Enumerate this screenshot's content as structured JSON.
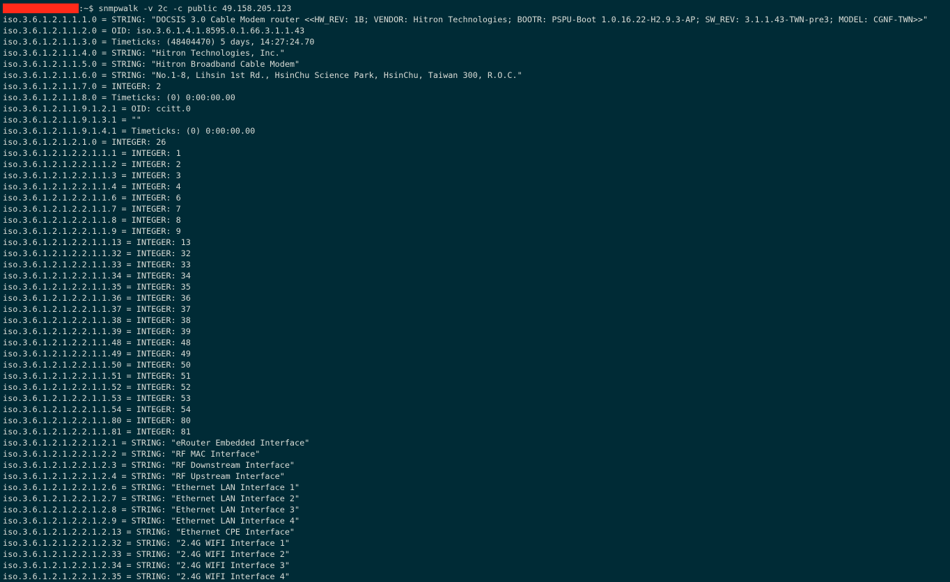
{
  "prompt": {
    "redaction_color": "#ff2a1a",
    "suffix": ":~$ ",
    "command": "snmpwalk -v 2c -c public 49.158.205.123"
  },
  "output_lines": [
    "iso.3.6.1.2.1.1.1.0 = STRING: \"DOCSIS 3.0 Cable Modem router <<HW_REV: 1B; VENDOR: Hitron Technologies; BOOTR: PSPU-Boot 1.0.16.22-H2.9.3-AP; SW_REV: 3.1.1.43-TWN-pre3; MODEL: CGNF-TWN>>\"",
    "iso.3.6.1.2.1.1.2.0 = OID: iso.3.6.1.4.1.8595.0.1.66.3.1.1.43",
    "iso.3.6.1.2.1.1.3.0 = Timeticks: (48404470) 5 days, 14:27:24.70",
    "iso.3.6.1.2.1.1.4.0 = STRING: \"Hitron Technologies, Inc.\"",
    "iso.3.6.1.2.1.1.5.0 = STRING: \"Hitron Broadband Cable Modem\"",
    "iso.3.6.1.2.1.1.6.0 = STRING: \"No.1-8, Lihsin 1st Rd., HsinChu Science Park, HsinChu, Taiwan 300, R.O.C.\"",
    "iso.3.6.1.2.1.1.7.0 = INTEGER: 2",
    "iso.3.6.1.2.1.1.8.0 = Timeticks: (0) 0:00:00.00",
    "iso.3.6.1.2.1.1.9.1.2.1 = OID: ccitt.0",
    "iso.3.6.1.2.1.1.9.1.3.1 = \"\"",
    "iso.3.6.1.2.1.1.9.1.4.1 = Timeticks: (0) 0:00:00.00",
    "iso.3.6.1.2.1.2.1.0 = INTEGER: 26",
    "iso.3.6.1.2.1.2.2.1.1.1 = INTEGER: 1",
    "iso.3.6.1.2.1.2.2.1.1.2 = INTEGER: 2",
    "iso.3.6.1.2.1.2.2.1.1.3 = INTEGER: 3",
    "iso.3.6.1.2.1.2.2.1.1.4 = INTEGER: 4",
    "iso.3.6.1.2.1.2.2.1.1.6 = INTEGER: 6",
    "iso.3.6.1.2.1.2.2.1.1.7 = INTEGER: 7",
    "iso.3.6.1.2.1.2.2.1.1.8 = INTEGER: 8",
    "iso.3.6.1.2.1.2.2.1.1.9 = INTEGER: 9",
    "iso.3.6.1.2.1.2.2.1.1.13 = INTEGER: 13",
    "iso.3.6.1.2.1.2.2.1.1.32 = INTEGER: 32",
    "iso.3.6.1.2.1.2.2.1.1.33 = INTEGER: 33",
    "iso.3.6.1.2.1.2.2.1.1.34 = INTEGER: 34",
    "iso.3.6.1.2.1.2.2.1.1.35 = INTEGER: 35",
    "iso.3.6.1.2.1.2.2.1.1.36 = INTEGER: 36",
    "iso.3.6.1.2.1.2.2.1.1.37 = INTEGER: 37",
    "iso.3.6.1.2.1.2.2.1.1.38 = INTEGER: 38",
    "iso.3.6.1.2.1.2.2.1.1.39 = INTEGER: 39",
    "iso.3.6.1.2.1.2.2.1.1.48 = INTEGER: 48",
    "iso.3.6.1.2.1.2.2.1.1.49 = INTEGER: 49",
    "iso.3.6.1.2.1.2.2.1.1.50 = INTEGER: 50",
    "iso.3.6.1.2.1.2.2.1.1.51 = INTEGER: 51",
    "iso.3.6.1.2.1.2.2.1.1.52 = INTEGER: 52",
    "iso.3.6.1.2.1.2.2.1.1.53 = INTEGER: 53",
    "iso.3.6.1.2.1.2.2.1.1.54 = INTEGER: 54",
    "iso.3.6.1.2.1.2.2.1.1.80 = INTEGER: 80",
    "iso.3.6.1.2.1.2.2.1.1.81 = INTEGER: 81",
    "iso.3.6.1.2.1.2.2.1.2.1 = STRING: \"eRouter Embedded Interface\"",
    "iso.3.6.1.2.1.2.2.1.2.2 = STRING: \"RF MAC Interface\"",
    "iso.3.6.1.2.1.2.2.1.2.3 = STRING: \"RF Downstream Interface\"",
    "iso.3.6.1.2.1.2.2.1.2.4 = STRING: \"RF Upstream Interface\"",
    "iso.3.6.1.2.1.2.2.1.2.6 = STRING: \"Ethernet LAN Interface 1\"",
    "iso.3.6.1.2.1.2.2.1.2.7 = STRING: \"Ethernet LAN Interface 2\"",
    "iso.3.6.1.2.1.2.2.1.2.8 = STRING: \"Ethernet LAN Interface 3\"",
    "iso.3.6.1.2.1.2.2.1.2.9 = STRING: \"Ethernet LAN Interface 4\"",
    "iso.3.6.1.2.1.2.2.1.2.13 = STRING: \"Ethernet CPE Interface\"",
    "iso.3.6.1.2.1.2.2.1.2.32 = STRING: \"2.4G WIFI Interface 1\"",
    "iso.3.6.1.2.1.2.2.1.2.33 = STRING: \"2.4G WIFI Interface 2\"",
    "iso.3.6.1.2.1.2.2.1.2.34 = STRING: \"2.4G WIFI Interface 3\"",
    "iso.3.6.1.2.1.2.2.1.2.35 = STRING: \"2.4G WIFI Interface 4\""
  ]
}
